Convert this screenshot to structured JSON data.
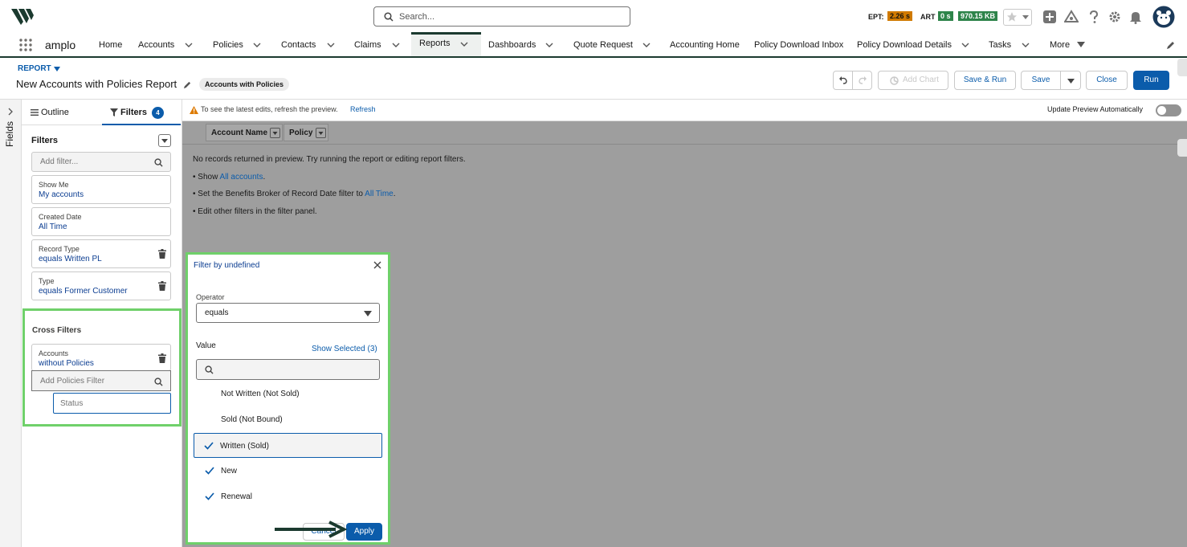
{
  "global": {
    "search_placeholder": "Search...",
    "ept_label": "EPT:",
    "ept_value": "2.26 s",
    "art_label": "ART",
    "art_value": "0 s",
    "size_value": "970.15 KB",
    "badge_colors": {
      "ept": "#d07a00",
      "art": "#2e844a",
      "size": "#2e844a"
    }
  },
  "nav": {
    "app_name": "amplo",
    "items": [
      {
        "label": "Home",
        "chevron": false,
        "active": false
      },
      {
        "label": "Accounts",
        "chevron": true,
        "active": false
      },
      {
        "label": "Policies",
        "chevron": true,
        "active": false
      },
      {
        "label": "Contacts",
        "chevron": true,
        "active": false
      },
      {
        "label": "Claims",
        "chevron": true,
        "active": false
      },
      {
        "label": "Reports",
        "chevron": true,
        "active": true
      },
      {
        "label": "Dashboards",
        "chevron": true,
        "active": false
      },
      {
        "label": "Quote Request",
        "chevron": true,
        "active": false
      },
      {
        "label": "Accounting Home",
        "chevron": false,
        "active": false
      },
      {
        "label": "Policy Download Inbox",
        "chevron": false,
        "active": false
      },
      {
        "label": "Policy Download Details",
        "chevron": true,
        "active": false
      },
      {
        "label": "Tasks",
        "chevron": true,
        "active": false
      },
      {
        "label": "More",
        "chevron": true,
        "active": false
      }
    ]
  },
  "report": {
    "kicker": "REPORT",
    "title": "New Accounts with Policies Report",
    "type_pill": "Accounts with Policies",
    "buttons": {
      "add_chart": "Add Chart",
      "save_run": "Save & Run",
      "save": "Save",
      "close": "Close",
      "run": "Run"
    }
  },
  "left": {
    "fields_label": "Fields",
    "tab_outline": "Outline",
    "tab_filters": "Filters",
    "filter_count": "4",
    "filters_heading": "Filters",
    "add_filter_placeholder": "Add filter...",
    "filters": [
      {
        "label": "Show Me",
        "value": "My accounts",
        "removable": false
      },
      {
        "label": "Created Date",
        "value": "All Time",
        "removable": false
      },
      {
        "label": "Record Type",
        "value": "equals Written PL",
        "removable": true
      },
      {
        "label": "Type",
        "value": "equals Former Customer",
        "removable": true
      }
    ],
    "cross_filters_heading": "Cross Filters",
    "cross_filter": {
      "label": "Accounts",
      "value": "without Policies"
    },
    "add_policies_placeholder": "Add Policies Filter",
    "status_placeholder": "Status"
  },
  "preview": {
    "info_text": "To see the latest edits, refresh the preview.",
    "refresh_link": "Refresh",
    "auto_update_label": "Update Preview Automatically",
    "columns": [
      "Account Name",
      "Policy"
    ],
    "no_records": "No records returned in preview. Try running the report or editing report filters.",
    "hint1_prefix": "• Show ",
    "hint1_link": "All accounts",
    "hint1_suffix": ".",
    "hint2_prefix": "• Set the Benefits Broker of Record Date filter to ",
    "hint2_link": "All Time",
    "hint2_suffix": ".",
    "hint3": "• Edit other filters in the filter panel."
  },
  "popover": {
    "title": "Filter by undefined",
    "operator_label": "Operator",
    "operator_value": "equals",
    "value_label": "Value",
    "show_selected": "Show Selected (3)",
    "options": [
      {
        "label": "Not Written (Not Sold)",
        "checked": false,
        "focused": false
      },
      {
        "label": "Sold (Not Bound)",
        "checked": false,
        "focused": false
      },
      {
        "label": "Written (Sold)",
        "checked": true,
        "focused": true
      },
      {
        "label": "New",
        "checked": true,
        "focused": false
      },
      {
        "label": "Renewal",
        "checked": true,
        "focused": false
      }
    ],
    "cancel": "Cancel",
    "apply": "Apply"
  }
}
